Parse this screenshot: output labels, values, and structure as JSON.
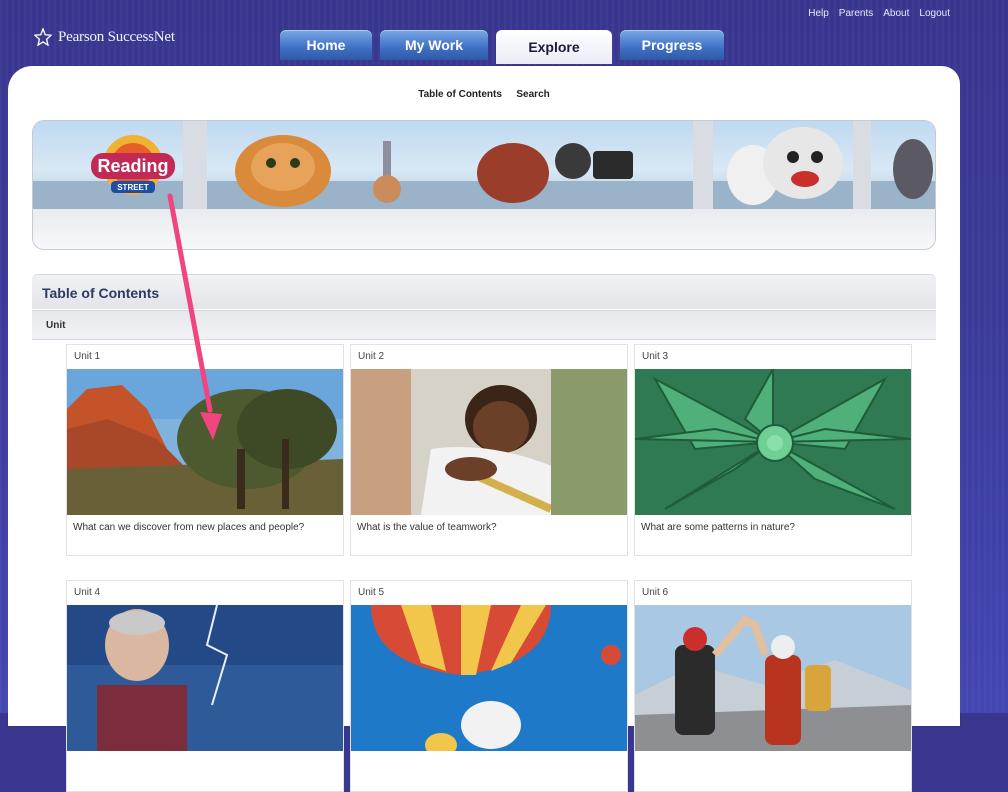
{
  "app": {
    "logo_text": "Pearson SuccessNet"
  },
  "util_links": [
    "Help",
    "Parents",
    "About",
    "Logout"
  ],
  "tabs": [
    {
      "label": "Home",
      "active": false
    },
    {
      "label": "My Work",
      "active": false
    },
    {
      "label": "Explore",
      "active": true
    },
    {
      "label": "Progress",
      "active": false
    }
  ],
  "subnav": {
    "toc": "Table of Contents",
    "search": "Search"
  },
  "banner": {
    "logo_top": "Reading",
    "logo_bottom": "STREET"
  },
  "toc": {
    "title": "Table of Contents",
    "column_header": "Unit"
  },
  "units": [
    {
      "label": "Unit 1",
      "question": "What can we discover from new places and people?"
    },
    {
      "label": "Unit 2",
      "question": "What is the value of teamwork?"
    },
    {
      "label": "Unit 3",
      "question": "What are some patterns in nature?"
    },
    {
      "label": "Unit 4",
      "question": ""
    },
    {
      "label": "Unit 5",
      "question": ""
    },
    {
      "label": "Unit 6",
      "question": ""
    }
  ],
  "colors": {
    "bg": "#3b3a98",
    "tab": "#3f6fc3",
    "arrow": "#f0457f"
  }
}
